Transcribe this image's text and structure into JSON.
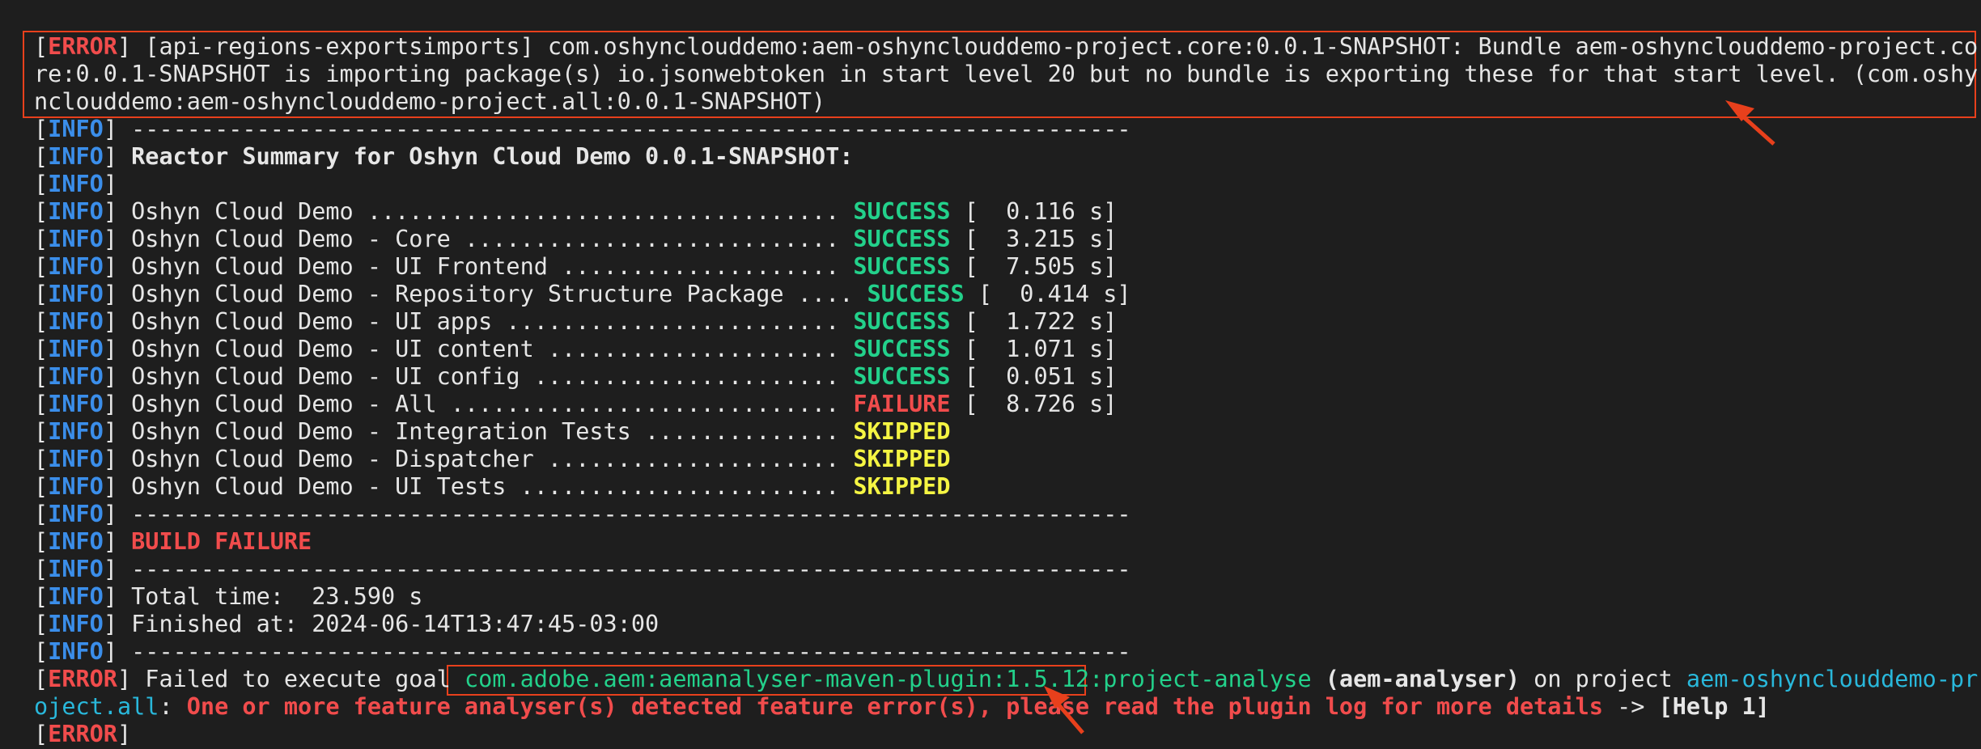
{
  "error_block": {
    "tag": "ERROR",
    "line1": " [api-regions-exportsimports] com.oshyncloud​demo:aem-oshyncloud​demo-project.core:0.0.1-SNAPSHOT: Bundle aem-oshyncloud​demo-project.co",
    "line2": "re:0.0.1-SNAPSHOT is importing package(s) io.jsonwebtoken in start level 20 but no bundle is exporting these for that start level. (com.oshy",
    "line3": "ncloud​demo:aem-oshyncloud​demo-project.all:0.0.1-SNAPSHOT)"
  },
  "info_tag": "INFO",
  "error_tag": "ERROR",
  "separator": "------------------------------------------------------------------------",
  "reactor_title": "Reactor Summary for Oshyn Cloud Demo 0.0.1-SNAPSHOT:",
  "modules": [
    {
      "name": "Oshyn Cloud Demo .................................. ",
      "status": "SUCCESS",
      "time": " [  0.116 s]",
      "kind": "success"
    },
    {
      "name": "Oshyn Cloud Demo - Core ........................... ",
      "status": "SUCCESS",
      "time": " [  3.215 s]",
      "kind": "success"
    },
    {
      "name": "Oshyn Cloud Demo - UI Frontend .................... ",
      "status": "SUCCESS",
      "time": " [  7.505 s]",
      "kind": "success"
    },
    {
      "name": "Oshyn Cloud Demo - Repository Structure Package .... ",
      "status": "SUCCESS",
      "time": " [  0.414 s]",
      "kind": "success"
    },
    {
      "name": "Oshyn Cloud Demo - UI apps ........................ ",
      "status": "SUCCESS",
      "time": " [  1.722 s]",
      "kind": "success"
    },
    {
      "name": "Oshyn Cloud Demo - UI content ..................... ",
      "status": "SUCCESS",
      "time": " [  1.071 s]",
      "kind": "success"
    },
    {
      "name": "Oshyn Cloud Demo - UI config ...................... ",
      "status": "SUCCESS",
      "time": " [  0.051 s]",
      "kind": "success"
    },
    {
      "name": "Oshyn Cloud Demo - All ............................ ",
      "status": "FAILURE",
      "time": " [  8.726 s]",
      "kind": "failure"
    },
    {
      "name": "Oshyn Cloud Demo - Integration Tests .............. ",
      "status": "SKIPPED",
      "time": "",
      "kind": "skipped"
    },
    {
      "name": "Oshyn Cloud Demo - Dispatcher ..................... ",
      "status": "SKIPPED",
      "time": "",
      "kind": "skipped"
    },
    {
      "name": "Oshyn Cloud Demo - UI Tests ....................... ",
      "status": "SKIPPED",
      "time": "",
      "kind": "skipped"
    }
  ],
  "build_result": "BUILD FAILURE",
  "total_time": "Total time:  23.590 s",
  "finished_at": "Finished at: 2024-06-14T13:47:45-03:00",
  "failed_goal": {
    "prefix": " Failed to execute goal ",
    "plugin": "com.adobe.aem:aemanalyser-maven-plugin:1.5.12",
    "goal": ":project-analyse ",
    "execution": "(aem-analyser)",
    "on_project": " on project ",
    "project_a": "aem-oshyncloud​demo-pr",
    "project_b": "oject.all",
    "colon": ": ",
    "message": "One or more feature analyser(s) detected feature error(s), please read the plugin log for more details",
    "arrow": " -> ",
    "help": "[Help 1]"
  },
  "colors": {
    "background": "#1e1e1e",
    "info": "#3b8eea",
    "error": "#f14c4c",
    "success": "#23d18b",
    "skipped": "#f5f543",
    "project": "#29b8db",
    "highlight": "#e8401c"
  },
  "icons": [
    "annotation-arrow-icon"
  ]
}
